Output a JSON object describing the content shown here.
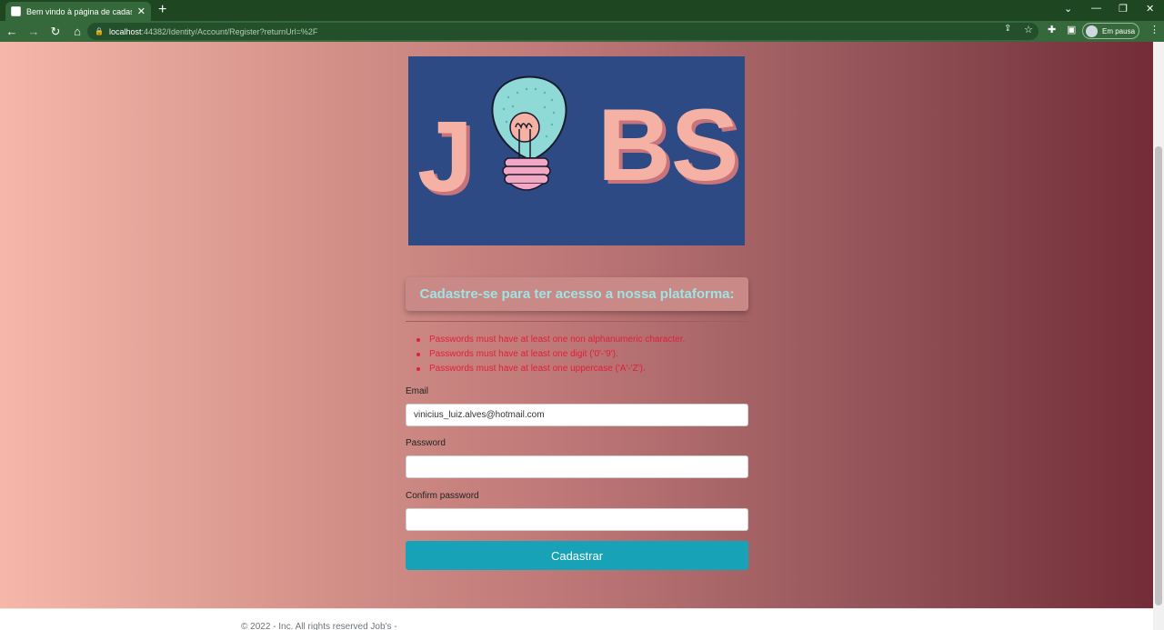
{
  "browser": {
    "tab_title": "Bem vindo à página de cadastro!",
    "tab_close": "✕",
    "new_tab": "+",
    "url_host": "localhost",
    "url_path": ":44382/Identity/Account/Register?returnUrl=%2F",
    "profile_label": "Em pausa"
  },
  "logo": {
    "text_left": "J",
    "text_right": "BS"
  },
  "register": {
    "heading": "Cadastre-se para ter acesso a nossa plataforma:",
    "errors": [
      "Passwords must have at least one non alphanumeric character.",
      "Passwords must have at least one digit ('0'-'9').",
      "Passwords must have at least one uppercase ('A'-'Z')."
    ],
    "email_label": "Email",
    "email_value": "vinicius_luiz.alves@hotmail.com",
    "password_label": "Password",
    "confirm_label": "Confirm password",
    "submit_label": "Cadastrar"
  },
  "footer": {
    "text": "© 2022 - Inc. All rights reserved Job's -"
  },
  "colors": {
    "accent": "#17a2b8",
    "error": "#e0203a",
    "logo_bg": "#2e4a85",
    "heading_text": "#9fe3e3"
  }
}
